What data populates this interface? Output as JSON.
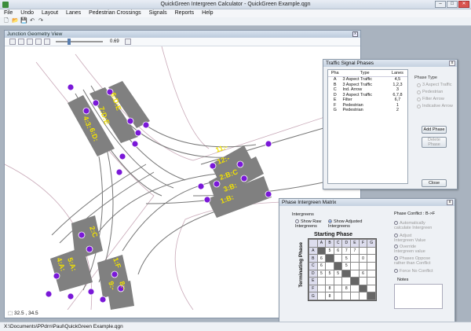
{
  "window": {
    "title": "QuickGreen Intergreen Calculator - QuickGreen Example.qgn"
  },
  "menu": [
    "File",
    "Undo",
    "Layout",
    "Lanes",
    "Pedestrian Crossings",
    "Signals",
    "Reports",
    "Help"
  ],
  "junction_view": {
    "title": "Junction Geometry View",
    "zoom": "0.69",
    "coords": "32.5 , 34.5",
    "labels": [
      "4:3:",
      "6:D:E",
      "7:D:E",
      "6:D:",
      "11:-",
      "12:-",
      "2:B:C",
      "3:B:",
      "1:B:",
      "2:C",
      "4:A:",
      "5:A:",
      "1:F",
      "9:-",
      "8:-"
    ]
  },
  "signal_phases": {
    "title": "Traffic Signal Phases",
    "headers": [
      "Pha",
      "Type",
      "Lanes"
    ],
    "rows": [
      [
        "A",
        "3 Aspect Traffic",
        "4,5"
      ],
      [
        "B",
        "3 Aspect Traffic",
        "1,2,3"
      ],
      [
        "C",
        "Ind. Arrow",
        "3"
      ],
      [
        "D",
        "3 Aspect Traffic",
        "6,7,8"
      ],
      [
        "E",
        "Filter",
        "6,7"
      ],
      [
        "F",
        "Pedestrian",
        "1"
      ],
      [
        "G",
        "Pedestrian",
        "2"
      ]
    ],
    "phase_type_label": "Phase Type",
    "phase_types": [
      "3 Aspect Traffic",
      "Pedestrian",
      "Filter Arrow",
      "Indicative Arrow"
    ],
    "add_label": "Add Phase",
    "delete_label": "Delete Phase",
    "close_label": "Close"
  },
  "intergreen": {
    "title": "Phase Intergreen Matrix",
    "intergreens_label": "Intergreens",
    "raw_label": "Show Raw Intergreens",
    "adjusted_label": "Show Adjusted Intergreens",
    "starting": "Starting Phase",
    "terminating": "Terminating Phase",
    "conflict_label": "Phase Conflict : B->F",
    "options": [
      "Automatically calculate Intergreen",
      "Adjust Intergreen Value",
      "Override Intergreen value",
      "Phases Oppose rather than Conflict",
      "Force No Conflict"
    ],
    "notes_label": "Notes",
    "cols": [
      "",
      "A",
      "B",
      "C",
      "D",
      "E",
      "F",
      "G"
    ],
    "matrix": [
      [
        "A",
        "",
        "5",
        "6",
        "7",
        "7",
        "",
        ""
      ],
      [
        "B",
        "6",
        "",
        "",
        "5",
        "",
        "0",
        ""
      ],
      [
        "C",
        "6",
        "",
        "",
        "5",
        "",
        "",
        ""
      ],
      [
        "D",
        "5",
        "5",
        "5",
        "",
        "",
        "6",
        ""
      ],
      [
        "E",
        "",
        "",
        "",
        "",
        "",
        "",
        ""
      ],
      [
        "F",
        "",
        "8",
        "",
        "8",
        "",
        "",
        ""
      ],
      [
        "G",
        "",
        "8",
        "",
        "",
        "",
        "",
        ""
      ]
    ]
  },
  "status": {
    "path": "X:\\Documents\\PPdrn\\Paul\\QuickGreen Example.qgn"
  }
}
